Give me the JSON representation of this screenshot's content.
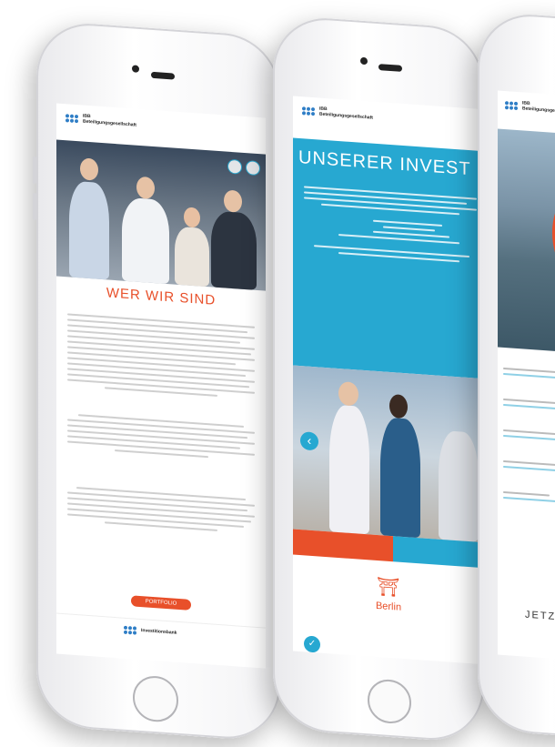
{
  "phone1": {
    "logo_text": [
      "IBB",
      "Beteiligungsgesellschaft"
    ],
    "heading": "WER WIR SIND",
    "portfolio_button": "PORTFOLIO",
    "footer_logo_text": "Investitionsbank"
  },
  "phone2": {
    "logo_text": [
      "IBB",
      "Beteiligungsgesellschaft"
    ],
    "section_title": "UNSERER INVEST",
    "city_label": "Berlin"
  },
  "phone3": {
    "logo_text": [
      "IBB",
      "Beteiligungsgesellschaft"
    ],
    "cta": "JETZT"
  },
  "colors": {
    "accent_orange": "#e8502a",
    "accent_teal": "#27a8d1",
    "logo_blue": "#2f7ec6"
  }
}
